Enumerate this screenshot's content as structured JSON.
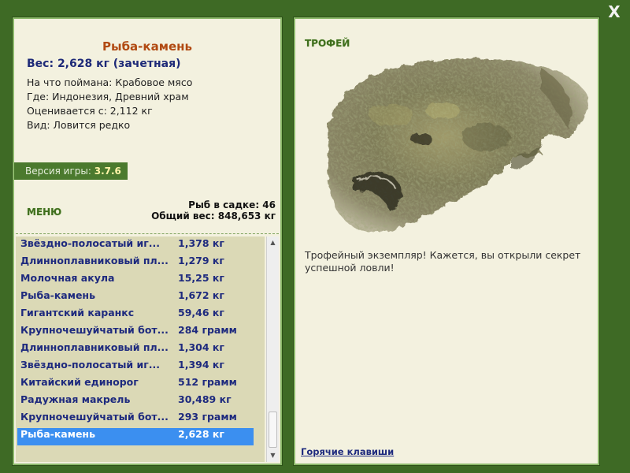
{
  "window": {
    "close_label": "X"
  },
  "fish": {
    "title": "Рыба-камень",
    "weight_line": "Вес: 2,628 кг (зачетная)",
    "info": [
      "На что поймана: Крабовое мясо",
      "Где: Индонезия, Древний храм",
      "Оценивается с: 2,112 кг",
      "Вид: Ловится редко"
    ]
  },
  "version": {
    "label": "Версия игры:",
    "value": "3.7.6"
  },
  "menu_label": "МЕНЮ",
  "stats": {
    "fish_count": "Рыб в садке: 46",
    "total_weight": "Общий вес: 848,653 кг"
  },
  "catch_list": [
    {
      "name": "Звёздно-полосатый иг...",
      "weight": "1,378 кг"
    },
    {
      "name": "Длинноплавниковый пл...",
      "weight": "1,279 кг"
    },
    {
      "name": "Молочная акула",
      "weight": "15,25 кг"
    },
    {
      "name": "Рыба-камень",
      "weight": "1,672 кг"
    },
    {
      "name": "Гигантский каранкс",
      "weight": "59,46 кг"
    },
    {
      "name": "Крупночешуйчатый бот...",
      "weight": "284 грамм"
    },
    {
      "name": "Длинноплавниковый пл...",
      "weight": "1,304 кг"
    },
    {
      "name": "Звёздно-полосатый иг...",
      "weight": "1,394 кг"
    },
    {
      "name": "Китайский единорог",
      "weight": "512 грамм"
    },
    {
      "name": "Радужная макрель",
      "weight": "30,489 кг"
    },
    {
      "name": "Крупночешуйчатый бот...",
      "weight": "293 грамм"
    },
    {
      "name": "Рыба-камень",
      "weight": "2,628 кг"
    }
  ],
  "selected_index": 11,
  "trophy": {
    "label": "ТРОФЕЙ",
    "text": "Трофейный экземпляр! Кажется, вы открыли секрет успешной ловли!"
  },
  "hotkeys_label": "Горячие клавиши",
  "colors": {
    "background": "#3e6a25",
    "panel": "#f3f1df",
    "title": "#b14a12",
    "list_text": "#1e2a7e",
    "selection": "#3b8ff0"
  }
}
